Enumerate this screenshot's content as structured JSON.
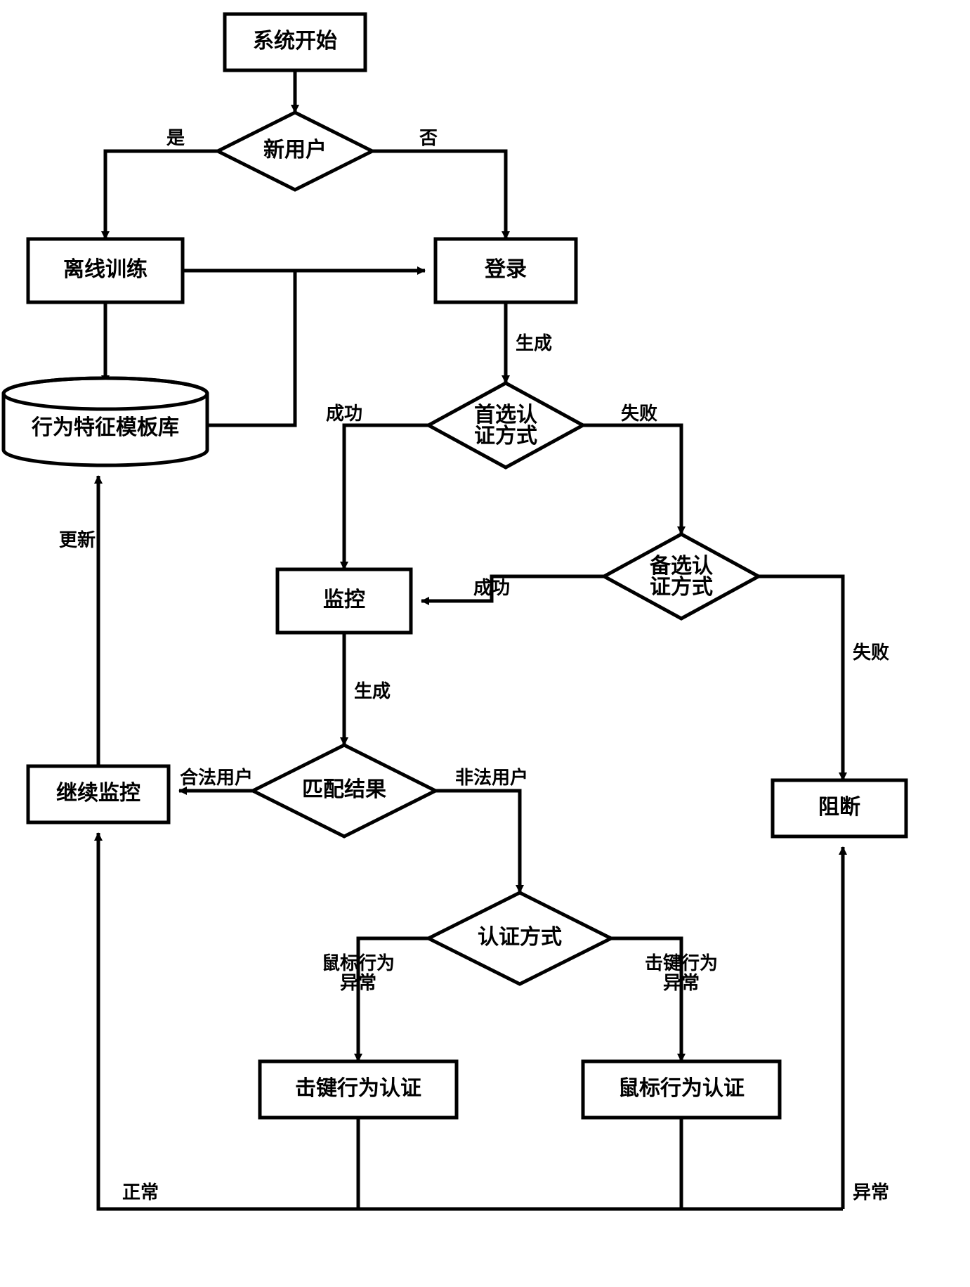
{
  "nodes": {
    "start": "系统开始",
    "newUser": "新用户",
    "offlineTrain": "离线训练",
    "login": "登录",
    "templateLib": "行为特征模板库",
    "preferredAuth1": "首选认",
    "preferredAuth2": "证方式",
    "altAuth1": "备选认",
    "altAuth2": "证方式",
    "monitor": "监控",
    "block": "阻断",
    "matchResult": "匹配结果",
    "continueMonitor": "继续监控",
    "authMode": "认证方式",
    "keystrokeAuth": "击键行为认证",
    "mouseAuth": "鼠标行为认证"
  },
  "edges": {
    "yes": "是",
    "no": "否",
    "generate": "生成",
    "success": "成功",
    "fail": "失败",
    "update": "更新",
    "legalUser": "合法用户",
    "illegalUser": "非法用户",
    "mouseAbnormal1": "鼠标行为",
    "mouseAbnormal2": "异常",
    "keystrokeAbnormal1": "击键行为",
    "keystrokeAbnormal2": "异常",
    "normal": "正常",
    "abnormal": "异常"
  }
}
